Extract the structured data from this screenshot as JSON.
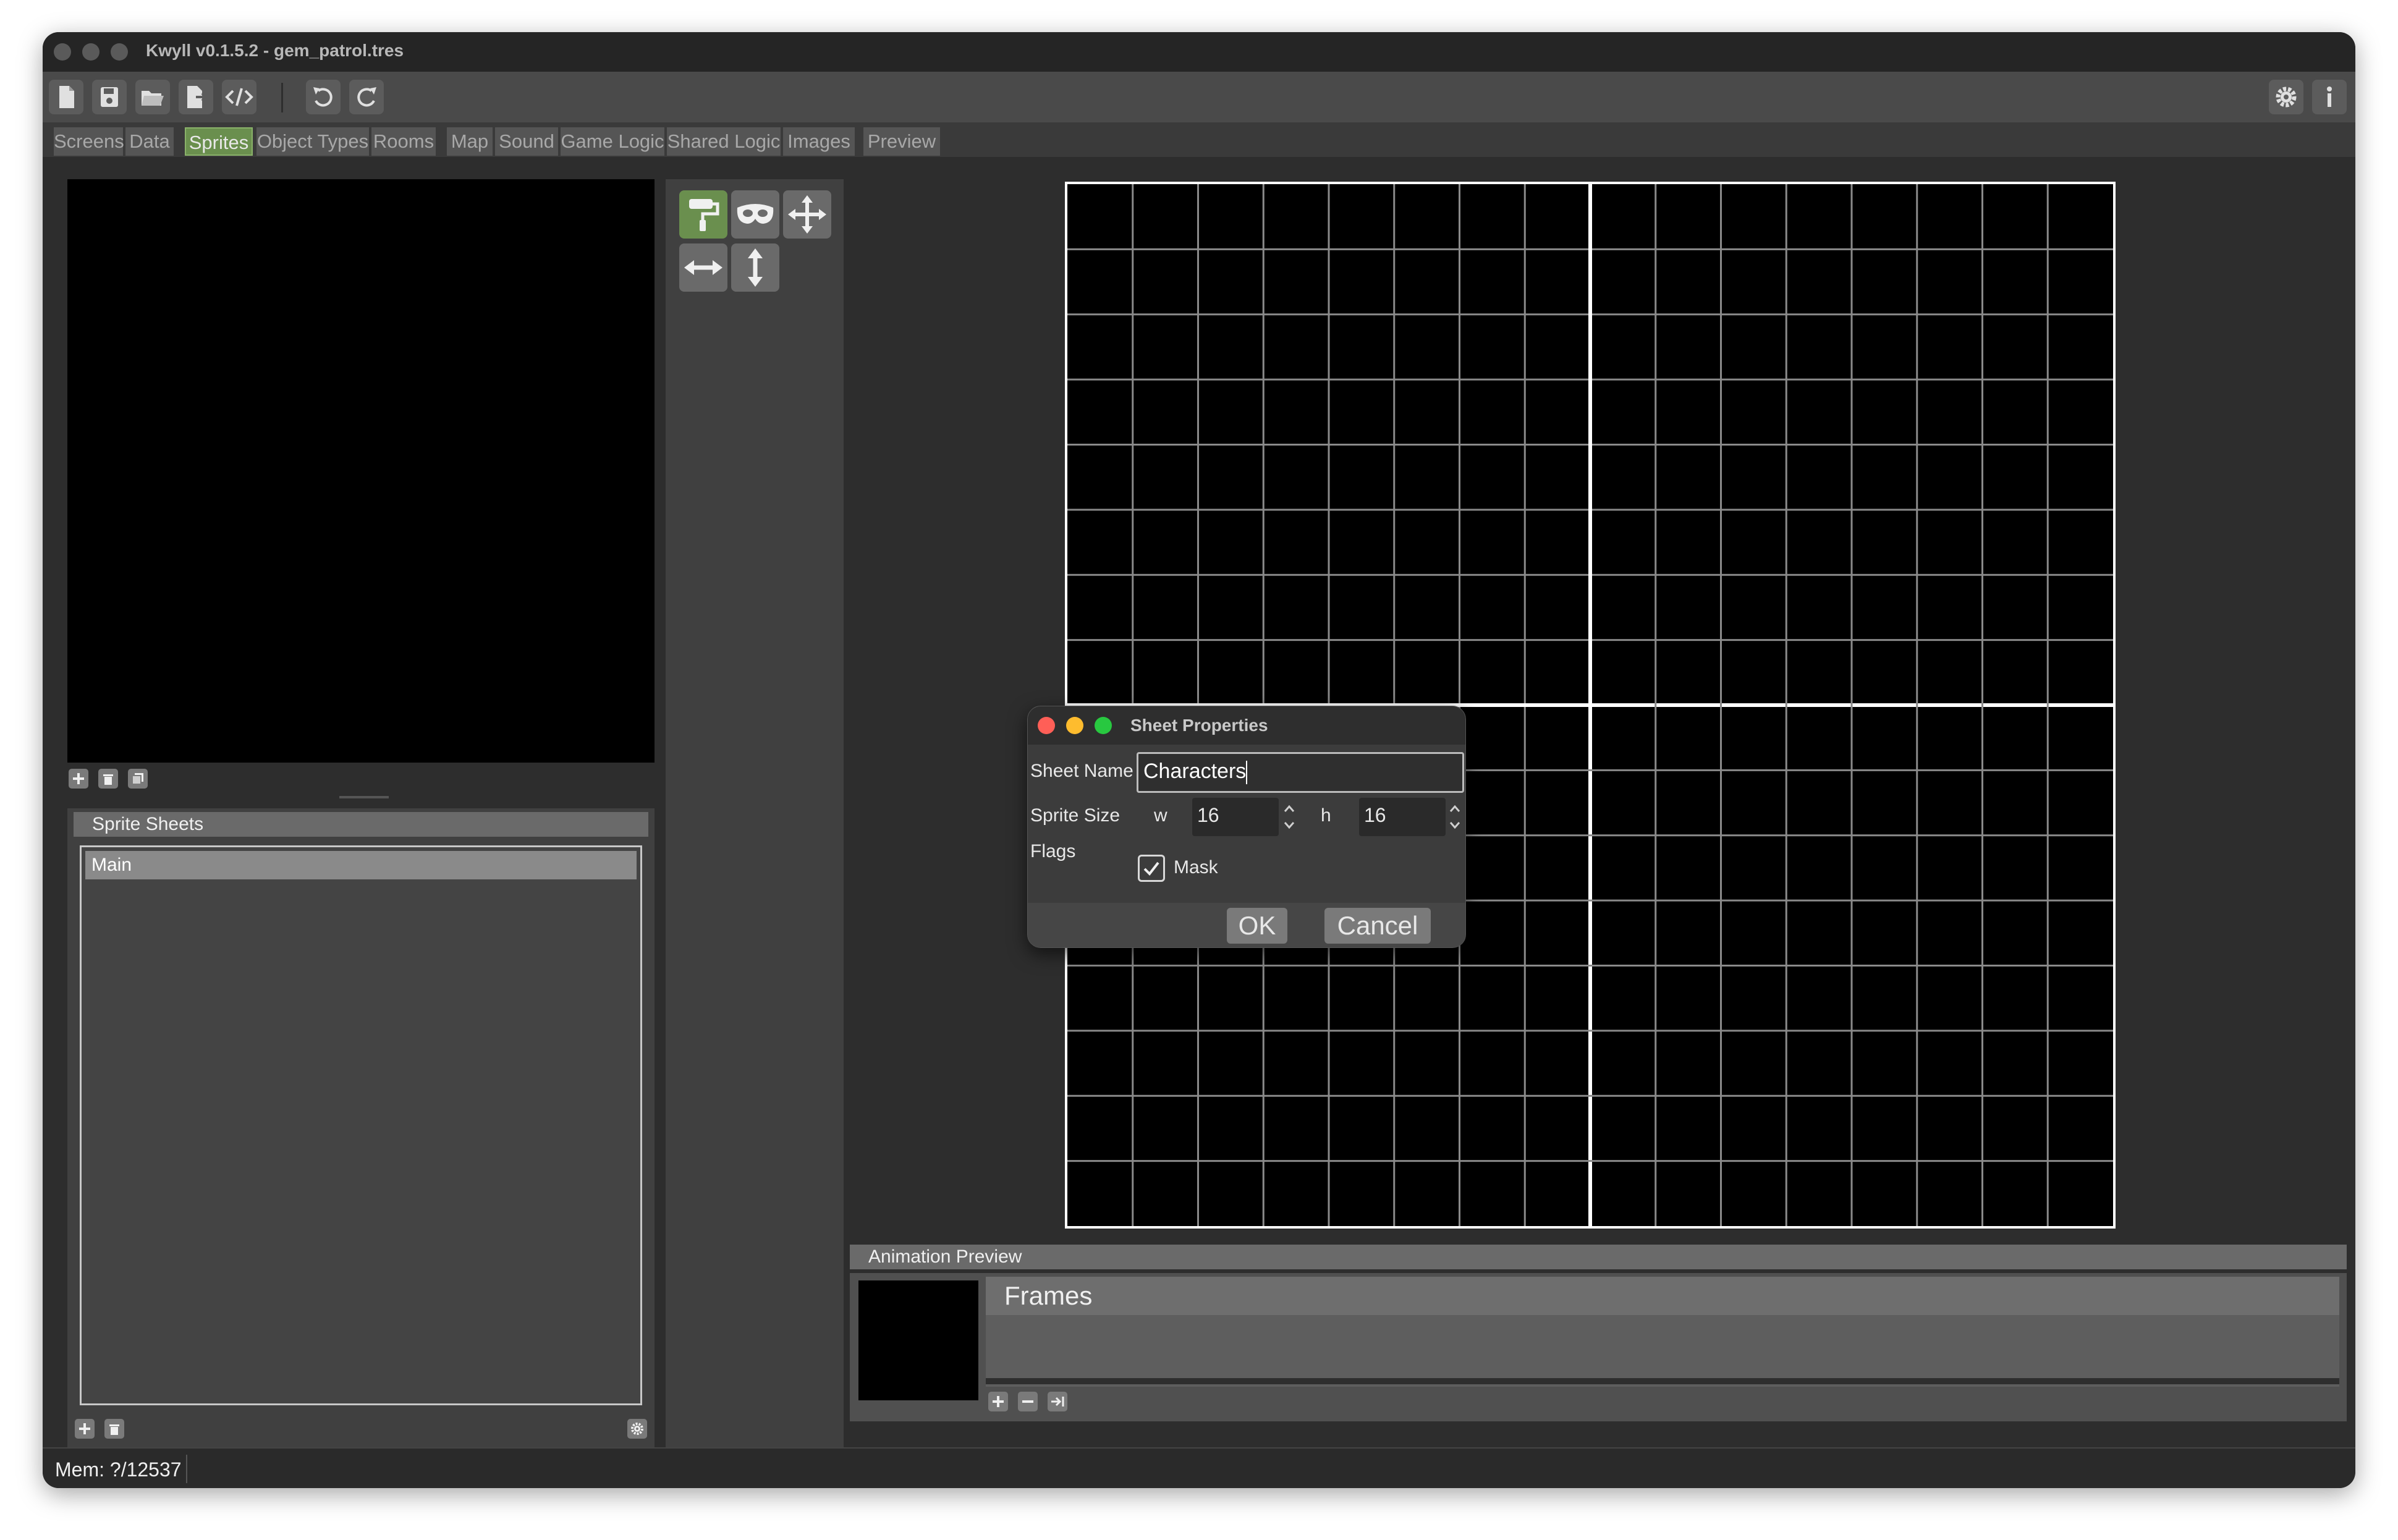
{
  "window": {
    "title": "Kwyll v0.1.5.2 - gem_patrol.tres"
  },
  "toolbar": {
    "buttons": [
      "new-file",
      "save",
      "open-folder",
      "export",
      "code",
      "undo",
      "redo"
    ],
    "right_buttons": [
      "settings",
      "info"
    ]
  },
  "tabs": [
    "Screens",
    "Data",
    "Sprites",
    "Object Types",
    "Rooms",
    "Map",
    "Sound",
    "Game Logic",
    "Shared Logic",
    "Images",
    "Preview"
  ],
  "active_tab": "Sprites",
  "sprite_sheets": {
    "header": "Sprite Sheets",
    "items": [
      "Main"
    ]
  },
  "tools": [
    "paint",
    "mask",
    "move",
    "flip-horizontal",
    "flip-vertical"
  ],
  "colors": {
    "accent": "#6a8f4e",
    "panel": "#404040",
    "background": "#2d2d2d"
  },
  "animation_preview": {
    "header": "Animation Preview",
    "frames_label": "Frames"
  },
  "dialog": {
    "title": "Sheet Properties",
    "sheet_name_label": "Sheet Name",
    "sheet_name_value": "Characters",
    "sprite_size_label": "Sprite Size",
    "w_label": "w",
    "w_value": "16",
    "h_label": "h",
    "h_value": "16",
    "flags_label": "Flags",
    "mask_label": "Mask",
    "mask_checked": true,
    "ok_label": "OK",
    "cancel_label": "Cancel"
  },
  "status": {
    "memory": "Mem: ?/12537"
  }
}
